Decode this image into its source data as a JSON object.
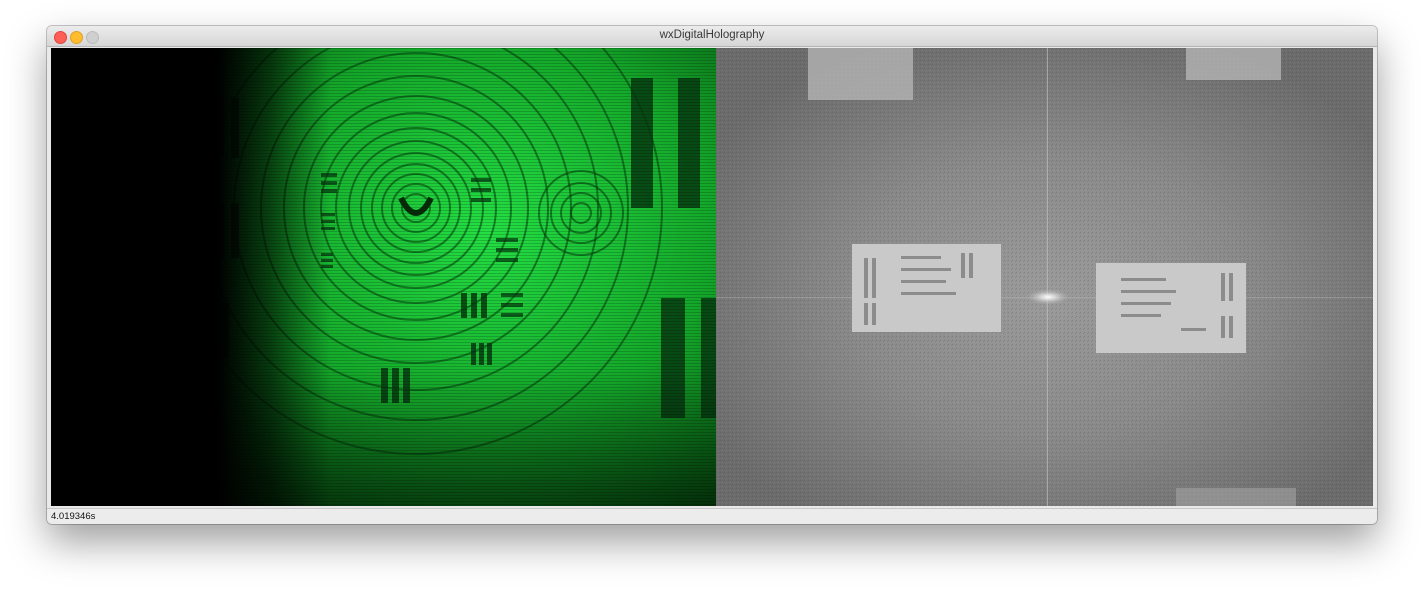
{
  "window": {
    "title": "wxDigitalHolography"
  },
  "panels": {
    "left": "hologram-image",
    "right": "fourier-spectrum-image"
  },
  "status": {
    "text": "4.019346s"
  },
  "colors": {
    "hologram_green": "#1fd23c",
    "spectrum_gray": "#8a8a8a",
    "titlebar": "#e4e4e4"
  }
}
